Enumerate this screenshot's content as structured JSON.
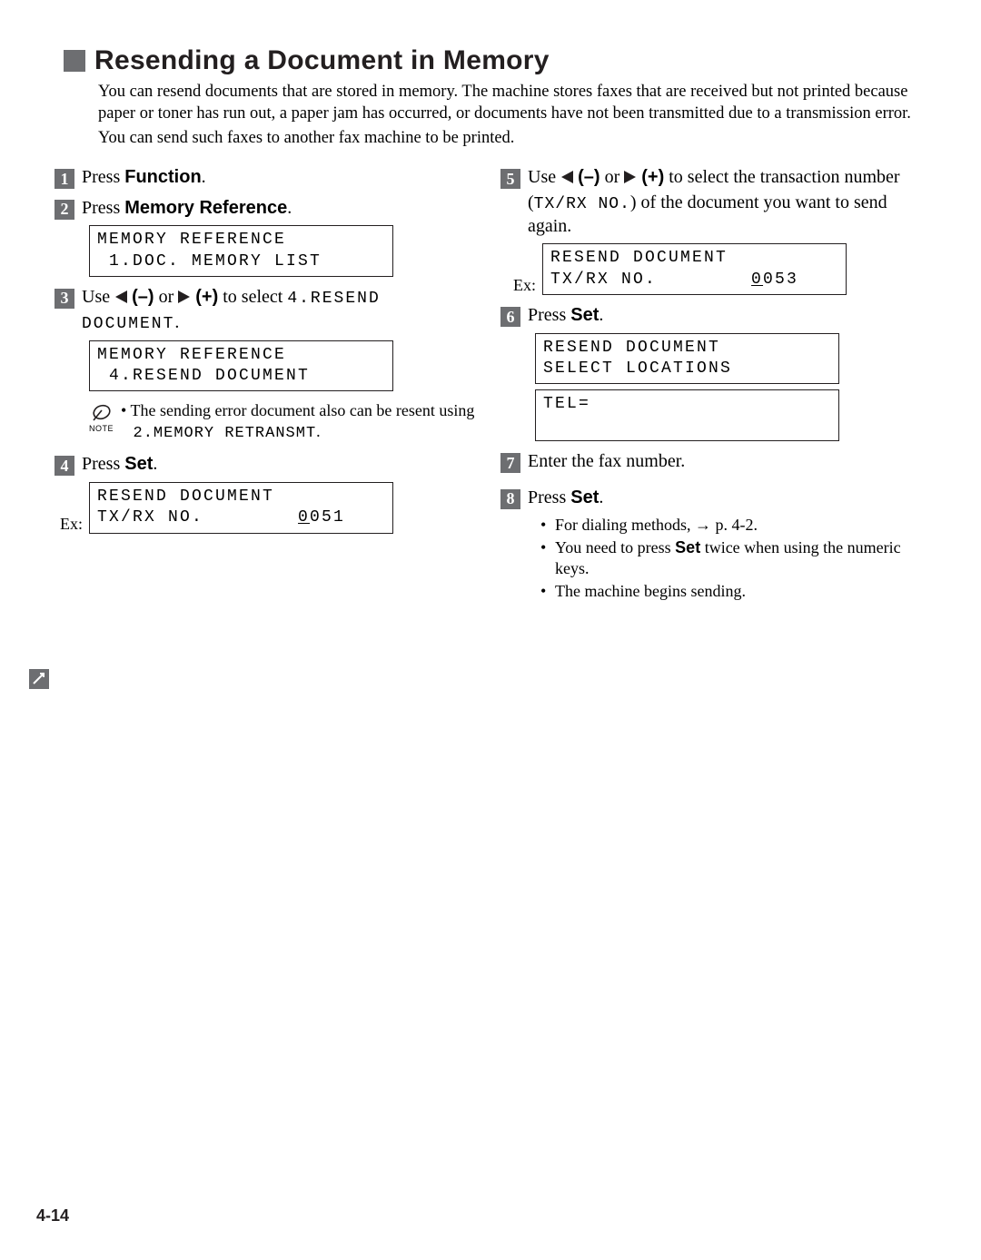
{
  "heading": "Resending a Document in Memory",
  "intro1": "You can resend documents that are stored in memory. The machine stores faxes that are received but not printed because paper or toner has run out, a paper jam has occurred, or documents have not been transmitted due to a transmission error.",
  "intro2": "You can send such faxes to another fax machine to be printed.",
  "left": {
    "s1": {
      "press": "Press ",
      "btn": "Function",
      "dot": "."
    },
    "s2": {
      "press": "Press ",
      "btn": "Memory Reference",
      "dot": ".",
      "lcd": "MEMORY REFERENCE\n 1.DOC. MEMORY LIST"
    },
    "s3": {
      "use": "Use ",
      "minus": "(–)",
      "or": " or ",
      "plus": "(+)",
      "rest": " to select ",
      "opt": "4.RESEND DOCUMENT",
      "dot2": ".",
      "below": "DOCUMENT",
      "lcd": "MEMORY REFERENCE\n 4.RESEND DOCUMENT",
      "note": "The sending error document also can be resent using ",
      "noteMono": "2.MEMORY RETRANSMT",
      "noteEnd": "."
    },
    "s4": {
      "press": "Press ",
      "btn": "Set",
      "dot": ".",
      "ex": "Ex:",
      "lcd1": "RESEND DOCUMENT",
      "lcd2a": "TX/RX NO.        ",
      "lcd2b": "0",
      "lcd2c": "051"
    }
  },
  "right": {
    "s5": {
      "use": "Use ",
      "minus": "(–)",
      "or": " or ",
      "plus": "(+)",
      "rest": " to select the transaction number (",
      "mono": "TX/RX NO.",
      "rest2": ") of the document you want to send again.",
      "ex": "Ex:",
      "lcd1": "RESEND DOCUMENT",
      "lcd2a": "TX/RX NO.        ",
      "lcd2b": "0",
      "lcd2c": "053"
    },
    "s6": {
      "press": "Press ",
      "btn": "Set",
      "dot": ".",
      "lcd1": "RESEND DOCUMENT\nSELECT LOCATIONS",
      "lcd2": "TEL=\n "
    },
    "s7": {
      "text": "Enter the fax number."
    },
    "s8": {
      "press": "Press ",
      "btn": "Set",
      "dot": ".",
      "b1a": "For dialing methods, ",
      "b1b": " p. 4-2.",
      "b2a": "You need to press ",
      "b2btn": "Set",
      "b2b": " twice when using the numeric keys.",
      "b3": "The machine begins sending."
    }
  },
  "noteLabel": "NOTE",
  "pageNum": "4-14"
}
